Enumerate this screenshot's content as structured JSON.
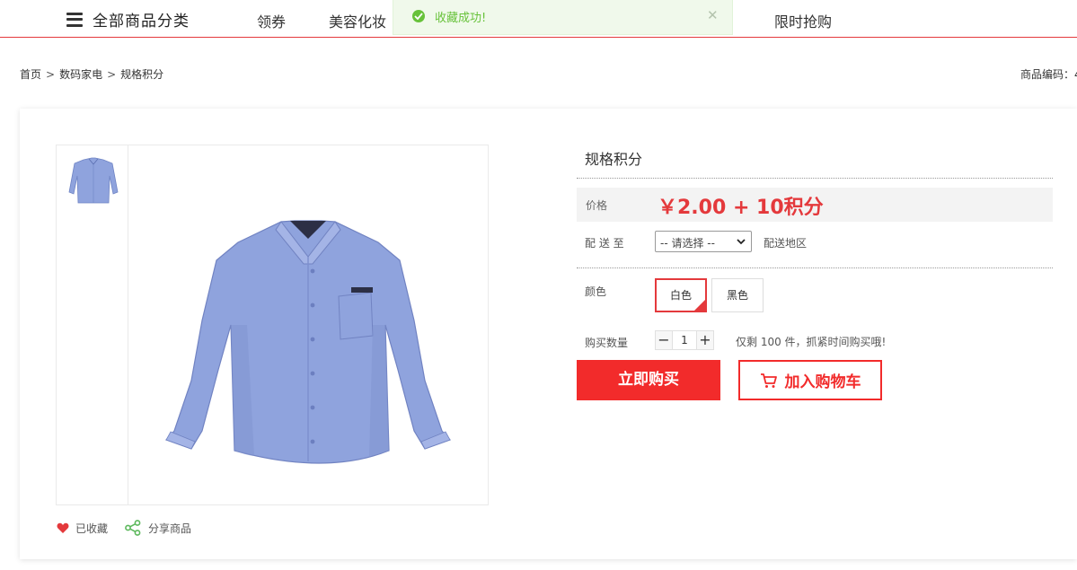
{
  "nav": {
    "category_label": "全部商品分类",
    "links": [
      "领券",
      "美容化妆",
      "限时抢购"
    ]
  },
  "toast": {
    "message": "收藏成功!"
  },
  "breadcrumb": {
    "items": [
      "首页",
      "数码家电",
      "规格积分"
    ],
    "separator": ">"
  },
  "sku_label": "商品编码：4",
  "product": {
    "title": "规格积分",
    "price_label": "价格",
    "price_value": "￥2.00 + 10积分",
    "delivery_label": "配 送 至",
    "delivery_select": "-- 请选择 --",
    "delivery_region": "配送地区",
    "color_label": "颜色",
    "colors": [
      "白色",
      "黑色"
    ],
    "selected_color": "白色",
    "quantity_label": "购买数量",
    "quantity": "1",
    "stock_note": "仅剩 100 件，抓紧时间购买哦!",
    "buy_now": "立即购买",
    "add_to_cart": "加入购物车",
    "favorited_label": "已收藏",
    "share_label": "分享商品"
  },
  "colors": {
    "accent": "#e4393c",
    "buy_button": "#f22b2b",
    "toast_green": "#67c23a",
    "shirt": "#8fa3dd"
  }
}
